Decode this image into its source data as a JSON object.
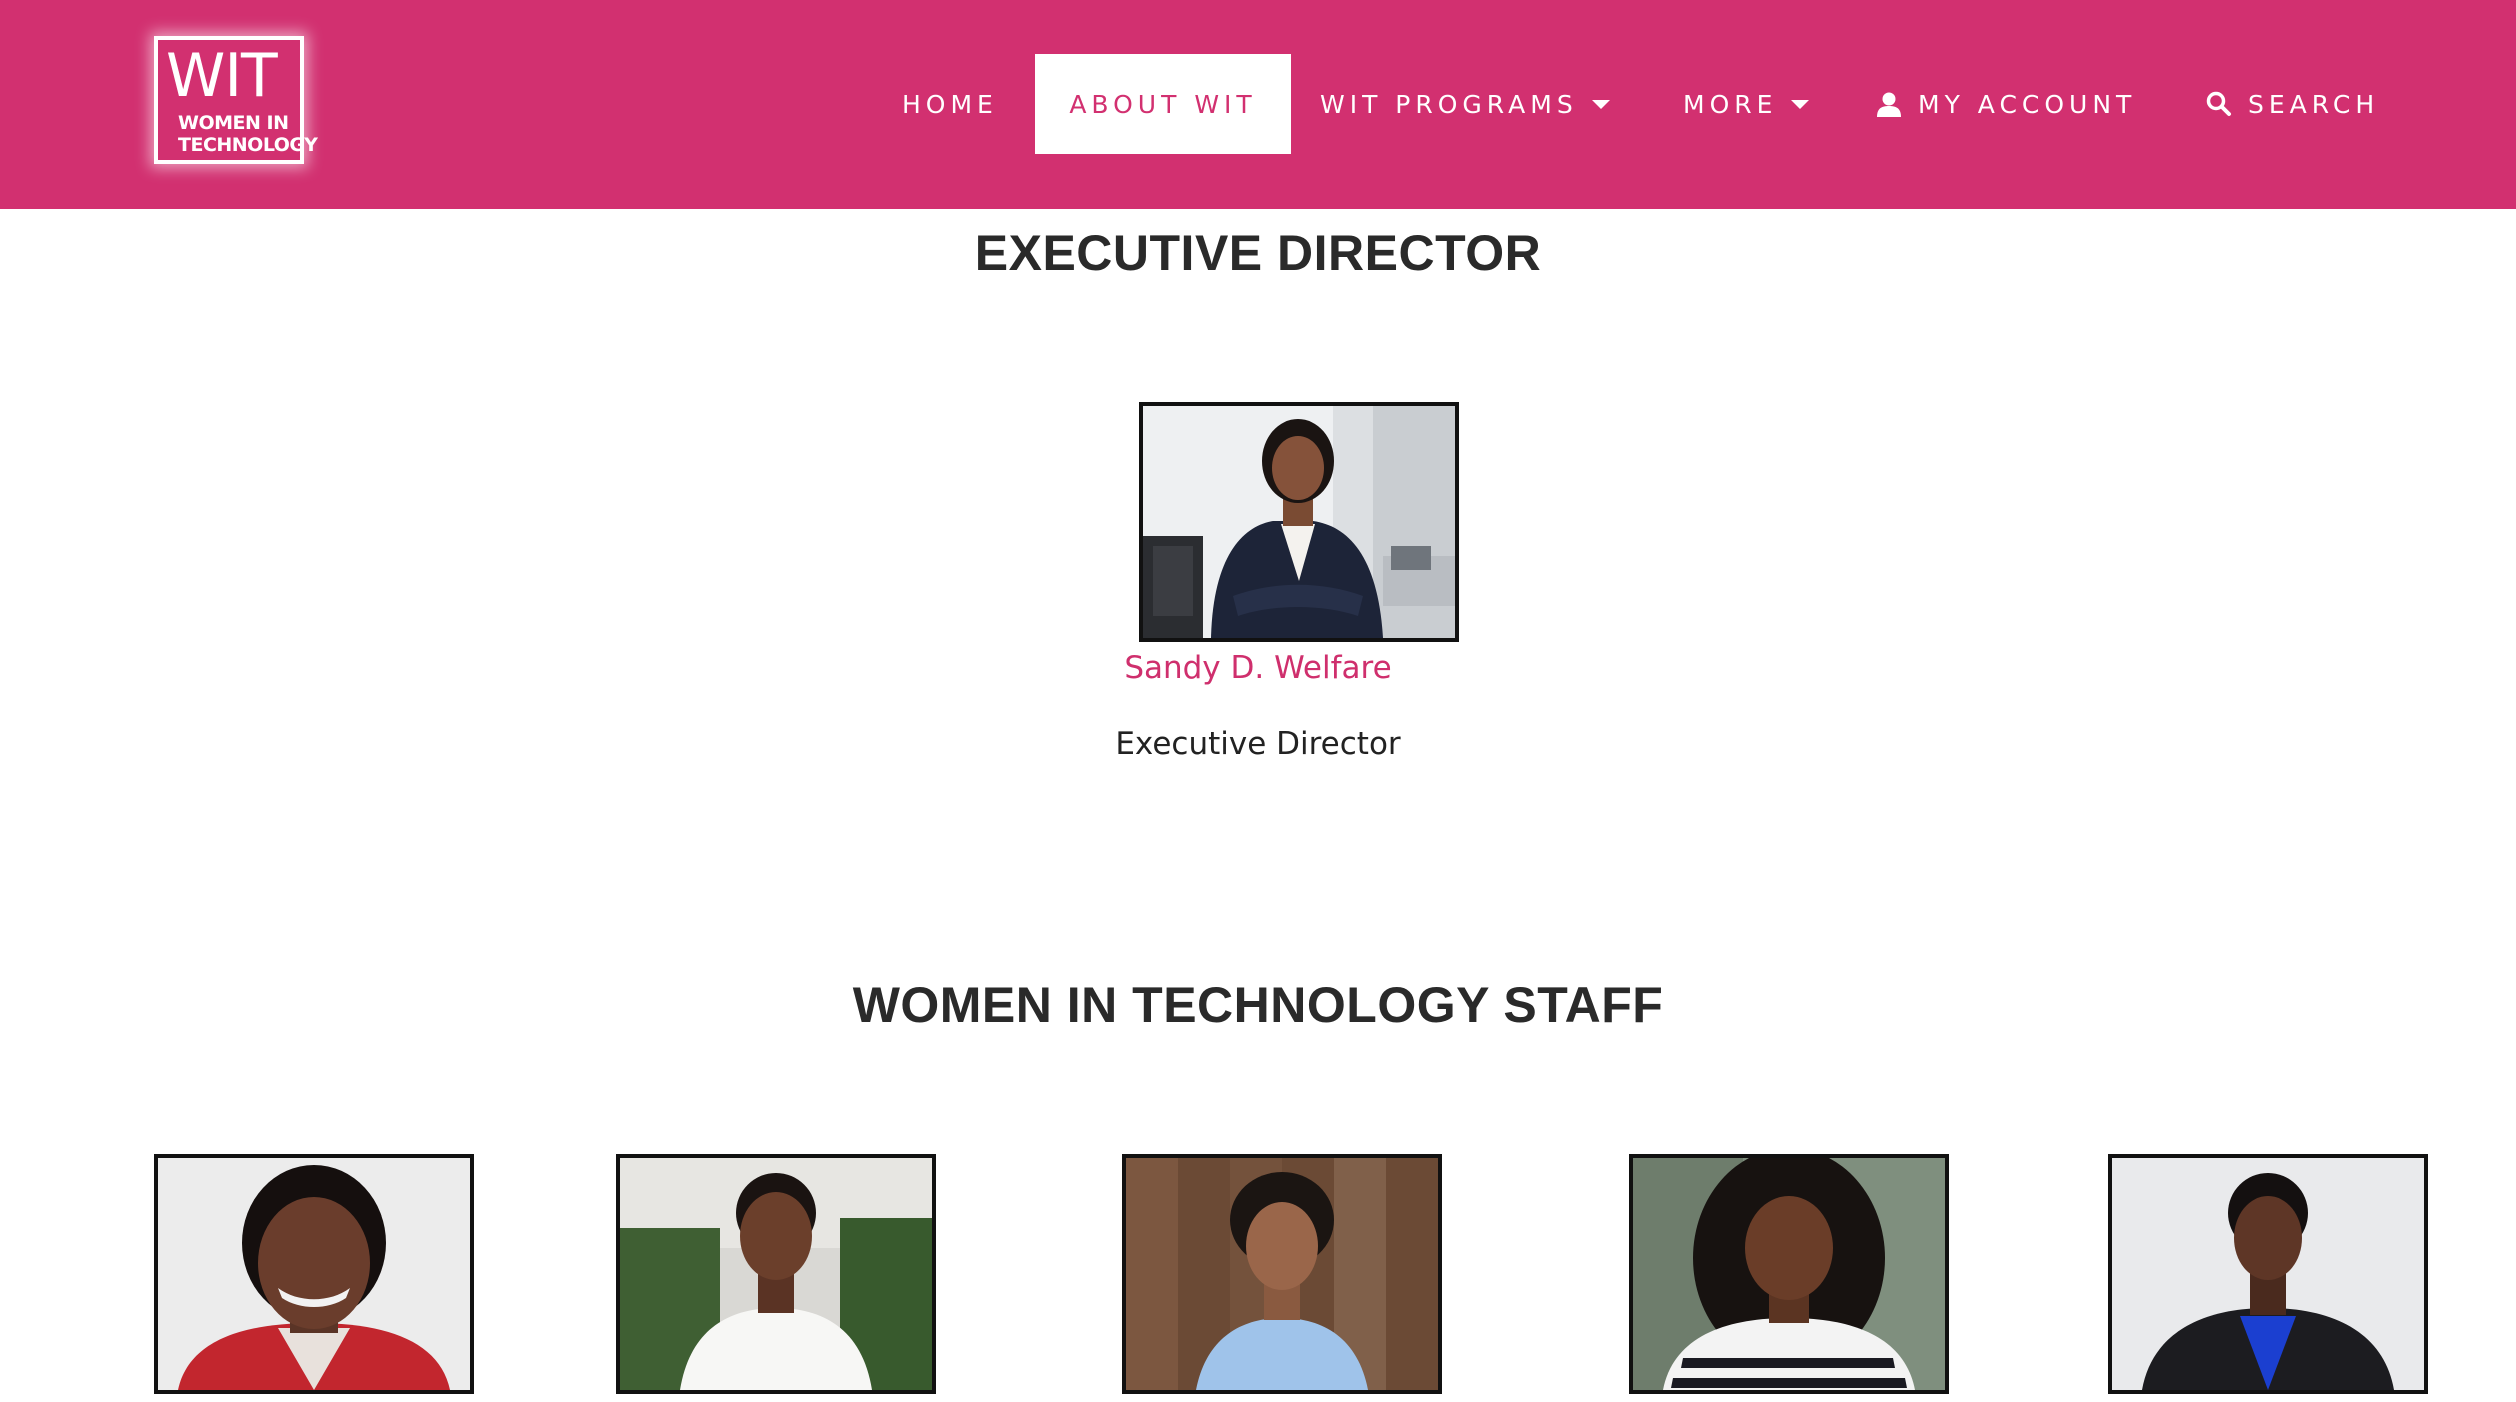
{
  "header": {
    "logo": {
      "big": "WIT",
      "line1": "WOMEN IN",
      "line2": "TECHNOLOGY"
    },
    "nav": {
      "home": "HOME",
      "about": "ABOUT WIT",
      "programs": "WIT PROGRAMS",
      "more": "MORE",
      "account": "MY ACCOUNT",
      "search": "SEARCH"
    },
    "colors": {
      "brand": "#d23070",
      "active_text": "#d23070",
      "text": "#ffffff"
    }
  },
  "executive": {
    "title": "EXECUTIVE DIRECTOR",
    "name": "Sandy D. Welfare",
    "role": "Executive Director"
  },
  "staff": {
    "title": "WOMEN IN TECHNOLOGY STAFF"
  }
}
